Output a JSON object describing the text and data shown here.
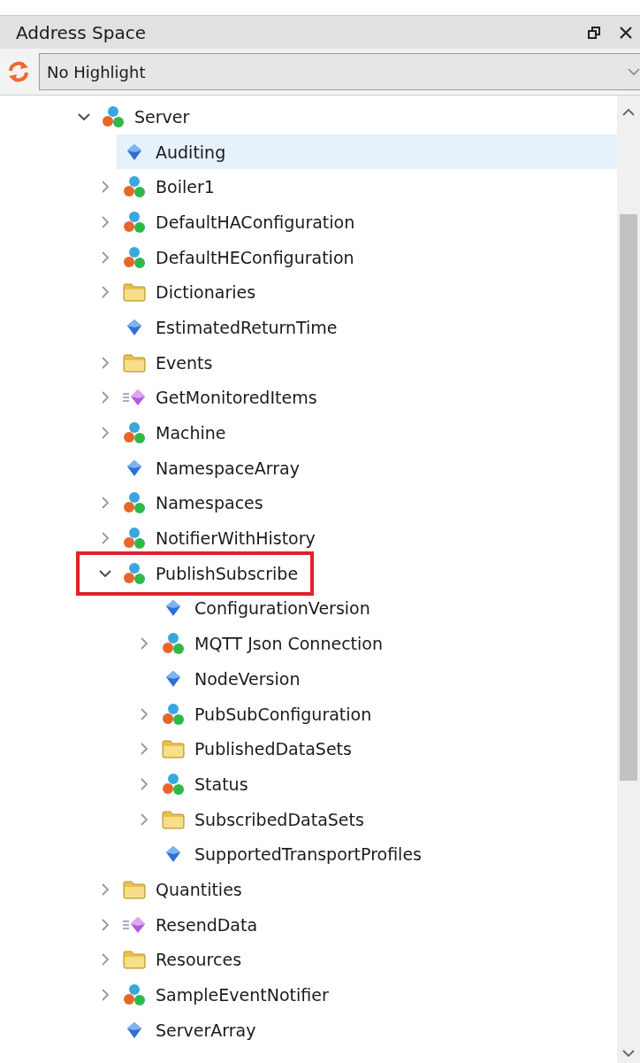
{
  "panel": {
    "title": "Address Space"
  },
  "toolbar": {
    "highlight_mode": "No Highlight"
  },
  "tree": [
    {
      "label": "Server",
      "kind": "object",
      "expandable": true,
      "expanded": true,
      "selected": false,
      "outlined": false,
      "children": [
        {
          "label": "Auditing",
          "kind": "variable",
          "expandable": false,
          "selected": true,
          "outlined": false
        },
        {
          "label": "Boiler1",
          "kind": "object",
          "expandable": true,
          "expanded": false,
          "selected": false,
          "outlined": false
        },
        {
          "label": "DefaultHAConfiguration",
          "kind": "object",
          "expandable": true,
          "expanded": false,
          "selected": false,
          "outlined": false
        },
        {
          "label": "DefaultHEConfiguration",
          "kind": "object",
          "expandable": true,
          "expanded": false,
          "selected": false,
          "outlined": false
        },
        {
          "label": "Dictionaries",
          "kind": "folder",
          "expandable": true,
          "expanded": false,
          "selected": false,
          "outlined": false
        },
        {
          "label": "EstimatedReturnTime",
          "kind": "variable",
          "expandable": false,
          "selected": false,
          "outlined": false
        },
        {
          "label": "Events",
          "kind": "folder",
          "expandable": true,
          "expanded": false,
          "selected": false,
          "outlined": false
        },
        {
          "label": "GetMonitoredItems",
          "kind": "method",
          "expandable": true,
          "expanded": false,
          "selected": false,
          "outlined": false
        },
        {
          "label": "Machine",
          "kind": "object",
          "expandable": true,
          "expanded": false,
          "selected": false,
          "outlined": false
        },
        {
          "label": "NamespaceArray",
          "kind": "variable",
          "expandable": false,
          "selected": false,
          "outlined": false
        },
        {
          "label": "Namespaces",
          "kind": "object",
          "expandable": true,
          "expanded": false,
          "selected": false,
          "outlined": false
        },
        {
          "label": "NotifierWithHistory",
          "kind": "object",
          "expandable": true,
          "expanded": false,
          "selected": false,
          "outlined": false
        },
        {
          "label": "PublishSubscribe",
          "kind": "object",
          "expandable": true,
          "expanded": true,
          "selected": false,
          "outlined": true,
          "children": [
            {
              "label": "ConfigurationVersion",
              "kind": "variable",
              "expandable": false,
              "selected": false,
              "outlined": false
            },
            {
              "label": "MQTT Json Connection",
              "kind": "object",
              "expandable": true,
              "expanded": false,
              "selected": false,
              "outlined": false
            },
            {
              "label": "NodeVersion",
              "kind": "variable",
              "expandable": false,
              "selected": false,
              "outlined": false
            },
            {
              "label": "PubSubConfiguration",
              "kind": "object",
              "expandable": true,
              "expanded": false,
              "selected": false,
              "outlined": false
            },
            {
              "label": "PublishedDataSets",
              "kind": "folder",
              "expandable": true,
              "expanded": false,
              "selected": false,
              "outlined": false
            },
            {
              "label": "Status",
              "kind": "object",
              "expandable": true,
              "expanded": false,
              "selected": false,
              "outlined": false
            },
            {
              "label": "SubscribedDataSets",
              "kind": "folder",
              "expandable": true,
              "expanded": false,
              "selected": false,
              "outlined": false
            },
            {
              "label": "SupportedTransportProfiles",
              "kind": "variable",
              "expandable": false,
              "selected": false,
              "outlined": false
            }
          ]
        },
        {
          "label": "Quantities",
          "kind": "folder",
          "expandable": true,
          "expanded": false,
          "selected": false,
          "outlined": false
        },
        {
          "label": "ResendData",
          "kind": "method",
          "expandable": true,
          "expanded": false,
          "selected": false,
          "outlined": false
        },
        {
          "label": "Resources",
          "kind": "folder",
          "expandable": true,
          "expanded": false,
          "selected": false,
          "outlined": false
        },
        {
          "label": "SampleEventNotifier",
          "kind": "object",
          "expandable": true,
          "expanded": false,
          "selected": false,
          "outlined": false
        },
        {
          "label": "ServerArray",
          "kind": "variable",
          "expandable": false,
          "selected": false,
          "outlined": false
        }
      ]
    }
  ]
}
